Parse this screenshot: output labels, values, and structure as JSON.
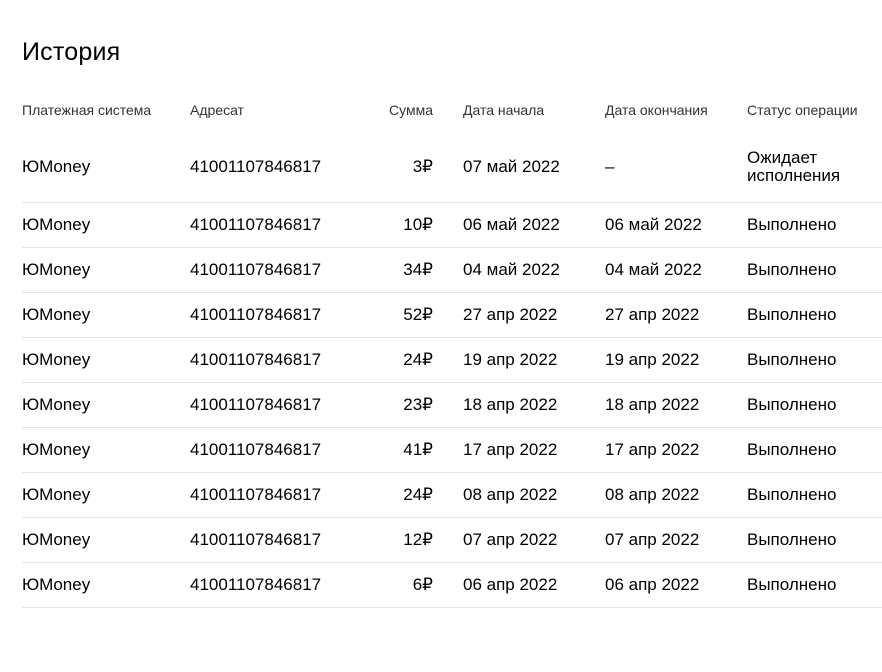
{
  "title": "История",
  "columns": {
    "system": "Платежная система",
    "address": "Адресат",
    "sum": "Сумма",
    "start": "Дата начала",
    "end": "Дата окончания",
    "status": "Статус операции"
  },
  "rows": [
    {
      "system": "ЮMoney",
      "address": "41001107846817",
      "sum": "3₽",
      "start": "07 май 2022",
      "end": "–",
      "status": "Ожидает исполнения"
    },
    {
      "system": "ЮMoney",
      "address": "41001107846817",
      "sum": "10₽",
      "start": "06 май 2022",
      "end": "06 май 2022",
      "status": "Выполнено"
    },
    {
      "system": "ЮMoney",
      "address": "41001107846817",
      "sum": "34₽",
      "start": "04 май 2022",
      "end": "04 май 2022",
      "status": "Выполнено"
    },
    {
      "system": "ЮMoney",
      "address": "41001107846817",
      "sum": "52₽",
      "start": "27 апр 2022",
      "end": "27 апр 2022",
      "status": "Выполнено"
    },
    {
      "system": "ЮMoney",
      "address": "41001107846817",
      "sum": "24₽",
      "start": "19 апр 2022",
      "end": "19 апр 2022",
      "status": "Выполнено"
    },
    {
      "system": "ЮMoney",
      "address": "41001107846817",
      "sum": "23₽",
      "start": "18 апр 2022",
      "end": "18 апр 2022",
      "status": "Выполнено"
    },
    {
      "system": "ЮMoney",
      "address": "41001107846817",
      "sum": "41₽",
      "start": "17 апр 2022",
      "end": "17 апр 2022",
      "status": "Выполнено"
    },
    {
      "system": "ЮMoney",
      "address": "41001107846817",
      "sum": "24₽",
      "start": "08 апр 2022",
      "end": "08 апр 2022",
      "status": "Выполнено"
    },
    {
      "system": "ЮMoney",
      "address": "41001107846817",
      "sum": "12₽",
      "start": "07 апр 2022",
      "end": "07 апр 2022",
      "status": "Выполнено"
    },
    {
      "system": "ЮMoney",
      "address": "41001107846817",
      "sum": "6₽",
      "start": "06 апр 2022",
      "end": "06 апр 2022",
      "status": "Выполнено"
    }
  ]
}
